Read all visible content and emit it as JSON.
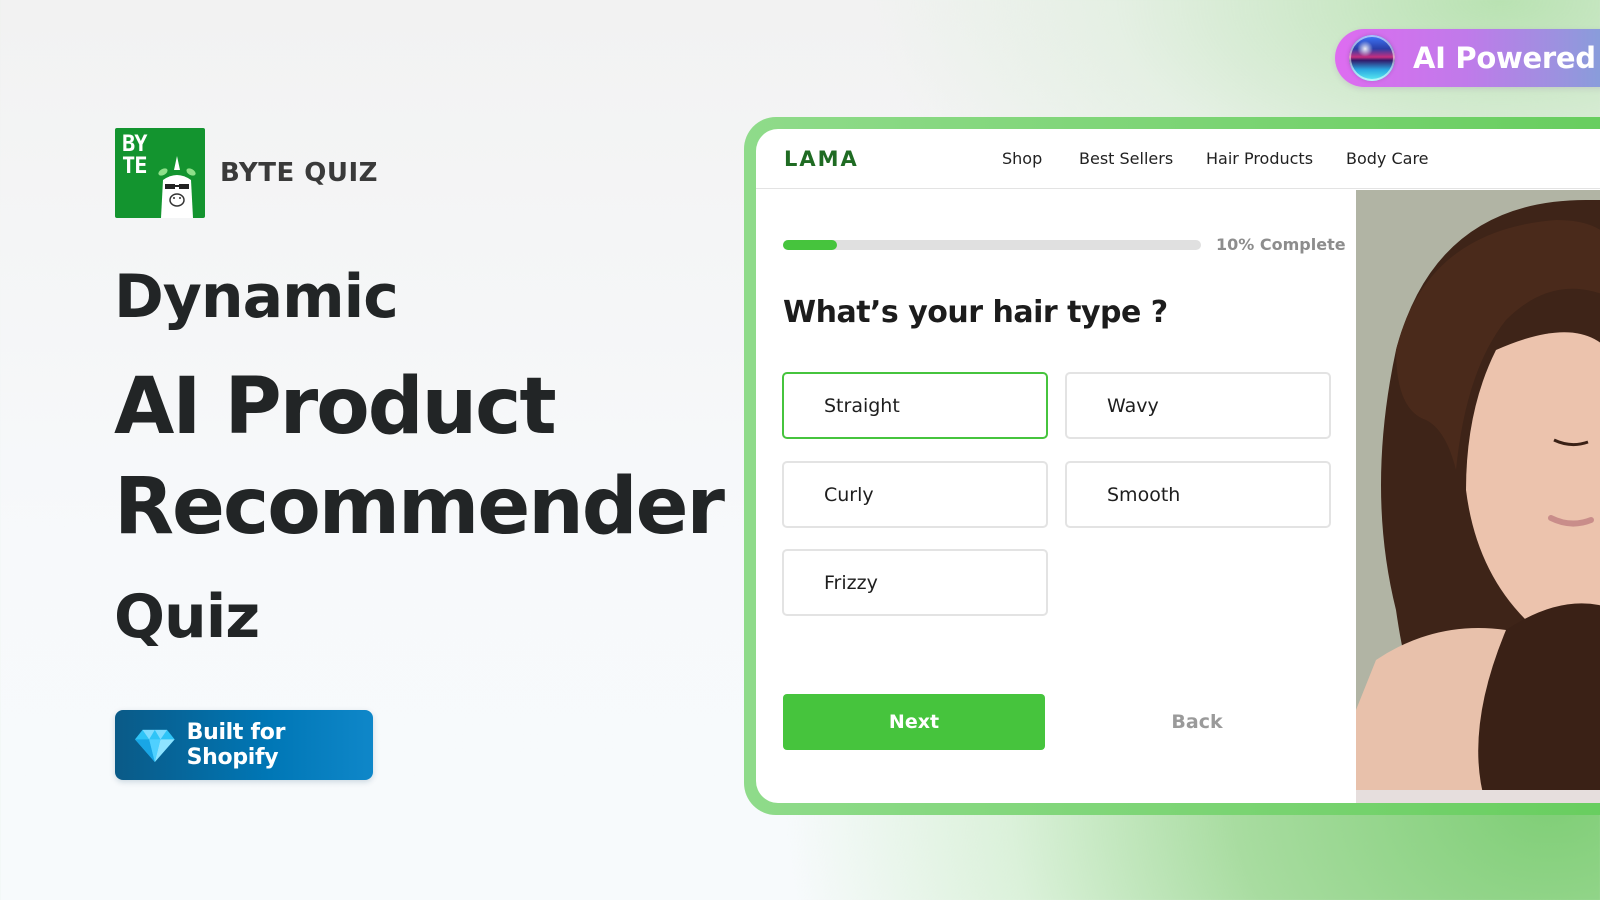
{
  "brand": {
    "logo_mark": "BY TE",
    "name": "BYTE QUIZ",
    "color": "#13942f"
  },
  "hero": {
    "line1": "Dynamic",
    "line2": "AI Product",
    "line3": "Recommender",
    "line4": "Quiz"
  },
  "shopify_badge": {
    "icon": "diamond-icon",
    "label": "Built for Shopify"
  },
  "ai_badge": {
    "icon": "orb-icon",
    "label": "AI Powered"
  },
  "store": {
    "logo": "LAMA",
    "nav": [
      "Shop",
      "Best Sellers",
      "Hair Products",
      "Body Care"
    ]
  },
  "quiz": {
    "progress_percent": 10,
    "progress_label": "10% Complete",
    "question": "What’s your hair type ?",
    "options": [
      {
        "label": "Straight",
        "selected": true
      },
      {
        "label": "Wavy",
        "selected": false
      },
      {
        "label": "Curly",
        "selected": false
      },
      {
        "label": "Smooth",
        "selected": false
      },
      {
        "label": "Frizzy",
        "selected": false
      }
    ],
    "next_label": "Next",
    "back_label": "Back",
    "accent_color": "#46c43d"
  },
  "photo": {
    "subject": "woman-with-long-brown-hair"
  }
}
